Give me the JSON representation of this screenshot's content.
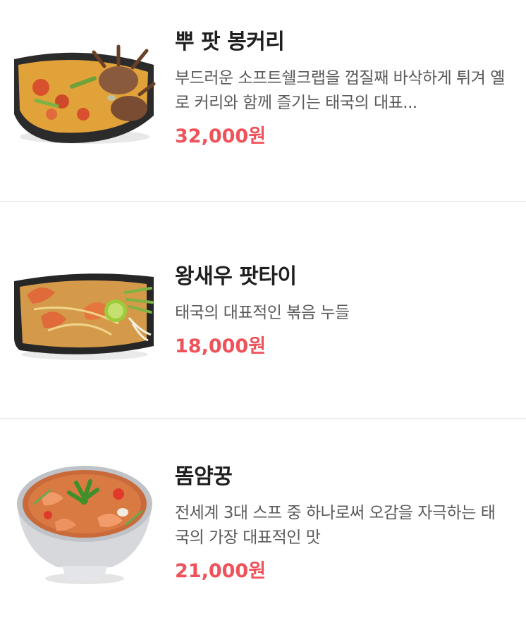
{
  "menu": {
    "items": [
      {
        "name": "뿌 팟 봉커리",
        "description": "부드러운 소프트쉘크랩을 껍질째 바삭하게 튀겨 옐로 커리와 함께 즐기는 태국의 대표...",
        "price": "32,000원",
        "image_icon": "crab-curry-dish-image"
      },
      {
        "name": "왕새우 팟타이",
        "description": "태국의 대표적인 볶음 누들",
        "price": "18,000원",
        "image_icon": "prawn-pad-thai-dish-image"
      },
      {
        "name": "똠얌꿍",
        "description": "전세계 3대 스프 중 하나로써 오감을 자극하는 태국의 가장 대표적인 맛",
        "price": "21,000원",
        "image_icon": "tom-yum-soup-bowl-image"
      }
    ]
  },
  "colors": {
    "price": "#f0525a",
    "title": "#1f1f1f",
    "description": "#5b5b5b",
    "divider": "#ececec"
  }
}
